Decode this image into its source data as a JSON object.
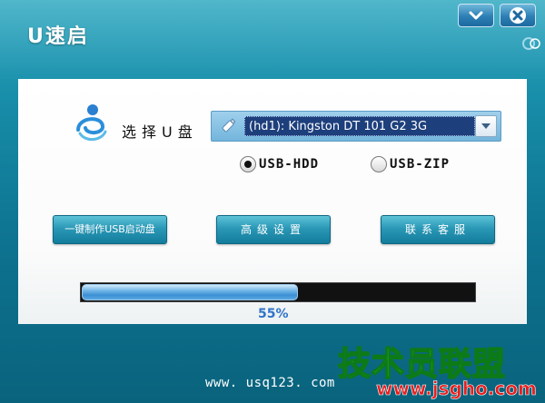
{
  "window": {
    "title": "U速启",
    "minimize_icon": "chevron-down-icon",
    "close_icon": "close-icon"
  },
  "drive": {
    "label": "选择U盘",
    "selected": "(hd1): Kingston DT 101 G2 3G",
    "icon": "usb-drive-icon"
  },
  "modes": [
    {
      "label": "USB-HDD",
      "checked": true
    },
    {
      "label": "USB-ZIP",
      "checked": false
    }
  ],
  "actions": {
    "make": "一键制作USB启动盘",
    "advanced": "高级设置",
    "support": "联系客服"
  },
  "progress": {
    "value": 55,
    "text": "55%"
  },
  "footer": {
    "website": "www. usq123. com"
  },
  "watermark": {
    "logo_text": "技术员联盟",
    "site_text": "www.jsgho.com"
  },
  "colors": {
    "chrome": "#168aa6",
    "button": "#2a98b6",
    "progress": "#3b8fd4",
    "progress_text": "#2f73c9",
    "selection": "#1d3f7c"
  }
}
